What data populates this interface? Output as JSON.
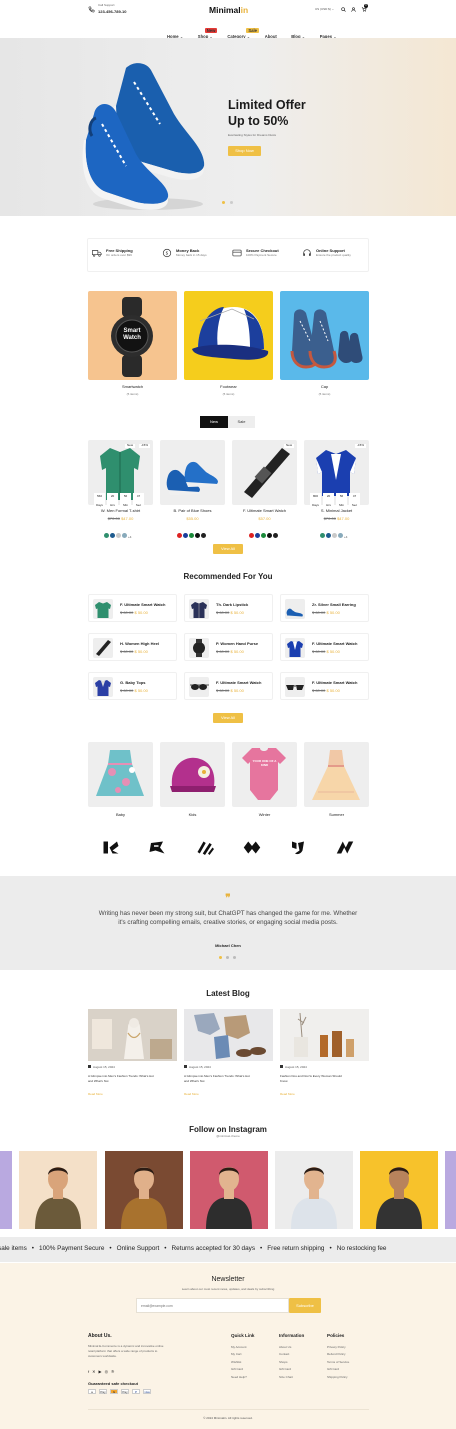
{
  "header": {
    "support_label": "Call Support",
    "support_phone": "123-456-789-10",
    "logo_main": "Minimal",
    "logo_accent": "in",
    "currency": "US (USD $)",
    "cart_count": "0",
    "nav": [
      {
        "label": "Home",
        "chev": "⌄"
      },
      {
        "label": "Shop",
        "chev": "⌄",
        "badge": "New"
      },
      {
        "label": "Category",
        "chev": "⌄",
        "badge": "Sale"
      },
      {
        "label": "About",
        "chev": ""
      },
      {
        "label": "Blog",
        "chev": "⌄"
      },
      {
        "label": "Pages",
        "chev": "⌄"
      }
    ]
  },
  "hero": {
    "title_1": "Limited Offer",
    "title_2": "Up to 50%",
    "subtitle": "Everlasting Styles for Dreams Dusts",
    "cta": "Shop Now"
  },
  "features": [
    {
      "title": "Free Shipping",
      "desc": "On orders over $99",
      "icon": "truck-icon"
    },
    {
      "title": "Money Back",
      "desc": "Money back in 15 days",
      "icon": "money-icon"
    },
    {
      "title": "Secure Checkout",
      "desc": "100% Payment Secure",
      "icon": "card-icon"
    },
    {
      "title": "Online Support",
      "desc": "Ensure the product quality",
      "icon": "headset-icon"
    }
  ],
  "categories": [
    {
      "name": "Smartwatch",
      "count": "(5 items)"
    },
    {
      "name": "Footwear",
      "count": "(5 items)"
    },
    {
      "name": "Cap",
      "count": "(5 items)"
    }
  ],
  "watch_text": "Smart Watch",
  "tabs": [
    "New",
    "Sale"
  ],
  "timer_units": [
    "Days",
    "Hrs",
    "Min",
    "Sec"
  ],
  "products": [
    {
      "name": "W. Men Formal T-shirt",
      "old": "$70.00",
      "price": "$47.00",
      "badges": [
        "New",
        "-15%"
      ],
      "timer": [
        "560",
        "20",
        "56",
        "47"
      ],
      "colors": [
        "#2f8f6e",
        "#1e5b8f",
        "#c9c9c9",
        "#8ab"
      ],
      "more": "+4"
    },
    {
      "name": "B. Pair of Blue Shoes",
      "old": "",
      "price": "$55.00",
      "badges": [],
      "timer": [],
      "colors": [
        "#d22",
        "#1b3d9b",
        "#1a8a3a",
        "#111",
        "#222"
      ],
      "more": ""
    },
    {
      "name": "F. Ultimate Smart Watch",
      "old": "",
      "price": "$57.00",
      "badges": [
        "New"
      ],
      "timer": [],
      "colors": [
        "#d22",
        "#1b3d9b",
        "#1a8a3a",
        "#111",
        "#222"
      ],
      "more": ""
    },
    {
      "name": "S. Minimal Jacket",
      "old": "$70.00",
      "price": "$47.00",
      "badges": [
        "-15%"
      ],
      "timer": [
        "800",
        "20",
        "56",
        "47"
      ],
      "colors": [
        "#2f8f6e",
        "#1e5b8f",
        "#c9c9c9",
        "#8ab"
      ],
      "more": "+4"
    }
  ],
  "view_all": "View All",
  "recommended": {
    "title": "Recommended For You",
    "items": [
      {
        "name": "F. Ultimate Smart Watch",
        "old": "$ 60.00",
        "price": "$ 50.00",
        "thumb": "shirt"
      },
      {
        "name": "Th. Dark Lipstick",
        "old": "$ 60.00",
        "price": "$ 50.00",
        "thumb": "jacket"
      },
      {
        "name": "Zr. Silver Small Earring",
        "old": "$ 60.00",
        "price": "$ 50.00",
        "thumb": "shoes"
      },
      {
        "name": "H. Women High Heel",
        "old": "$ 60.00",
        "price": "$ 50.00",
        "thumb": "watchband"
      },
      {
        "name": "P. Women Hand Purse",
        "old": "$ 60.00",
        "price": "$ 50.00",
        "thumb": "watch"
      },
      {
        "name": "F. Ultimate Smart Watch",
        "old": "$ 60.00",
        "price": "$ 50.00",
        "thumb": "varsity"
      },
      {
        "name": "G. Baby Tops",
        "old": "$ 60.00",
        "price": "$ 50.00",
        "thumb": "blazer"
      },
      {
        "name": "F. Ultimate Smart Watch",
        "old": "$ 60.00",
        "price": "$ 50.00",
        "thumb": "glasses"
      },
      {
        "name": "F. Ultimate Smart Watch",
        "old": "$ 60.00",
        "price": "$ 50.00",
        "thumb": "sunglasses"
      }
    ]
  },
  "kids_categories": [
    "Baby",
    "Kids",
    "Winter",
    "Summer"
  ],
  "onesie_text": "YOUR ONE OF A KIND",
  "testimonial": {
    "quote_line_1": "Writing has never been my strong suit, but ChatGPT has changed the game for me. Whether",
    "quote_line_2": "it's crafting compelling emails, creative stories, or engaging social media posts.",
    "author": "Michael Chen"
  },
  "blog": {
    "title": "Latest Blog",
    "posts": [
      {
        "date": "August 15, 2024",
        "title_1": "A Glimpse into Men's Fashion Trends: What's Hot",
        "title_2": "and What's Not",
        "link": "Read More"
      },
      {
        "date": "August 15, 2024",
        "title_1": "A Glimpse into Men's Fashion Trends: What's Hot",
        "title_2": "and What's Not",
        "link": "Read More"
      },
      {
        "date": "August 15, 2024",
        "title_1": "Fashion Dos and Don'ts Every Woman Should",
        "title_2": "Know",
        "link": "Read More"
      }
    ]
  },
  "instagram": {
    "title": "Follow on Instagram",
    "handle": "@minimaL.theme"
  },
  "ticker": [
    "sale items",
    "100% Payment Secure",
    "Online Support",
    "Returns accepted for 30 days",
    "Free return shipping",
    "No restocking fee"
  ],
  "newsletter": {
    "title": "Newsletter",
    "desc": "Learn about our most recent news, updates, and deals by subscribing",
    "placeholder": "email@example.com",
    "button": "Subscribe"
  },
  "footer": {
    "about_title": "About Us.",
    "about_1": "Minimal E-Commerce is a dynamic and innovative online",
    "about_2": "retail platform that offers a wide range of products to",
    "about_3": "customers worldwide.",
    "checkout_title": "Guaranteed safe checkout",
    "payments": [
      "a",
      "Pay",
      "G",
      "Pay",
      "P",
      "visa"
    ],
    "columns": [
      {
        "title": "Quick Link",
        "links": [
          "My Account",
          "My Cart",
          "Wishlist",
          "Gift Card",
          "Need Help?"
        ]
      },
      {
        "title": "Information",
        "links": [
          "About Us",
          "Contact",
          "Shops",
          "Gift Card",
          "Size Chart"
        ]
      },
      {
        "title": "Policies",
        "links": [
          "Privacy Policy",
          "Refund Policy",
          "Terms of Service",
          "Gift Card",
          "Shipping Policy"
        ]
      }
    ],
    "copyright": "© 2024 Minimalin. All rights reserved."
  },
  "colors": {
    "accent": "#efc045",
    "price": "#e8b23b",
    "dark": "#111111"
  }
}
